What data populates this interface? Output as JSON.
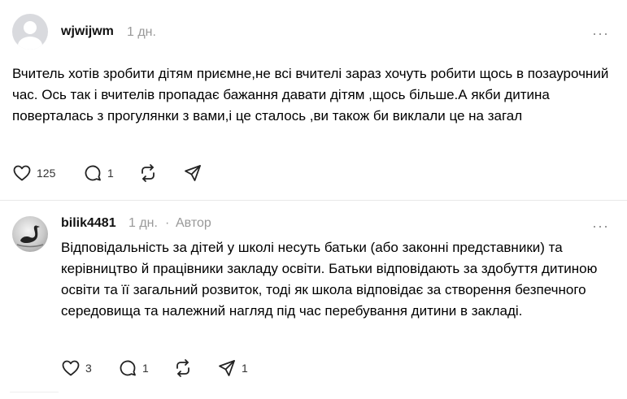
{
  "comments": [
    {
      "username": "wjwijwm",
      "time": "1 дн.",
      "author_tag": "",
      "text": "Вчитель хотів зробити дітям приємне,не всі вчителі зараз хочуть робити щось в позаурочний час. Ось так і вчителів пропадає бажання давати дітям ,щось більше.А якби дитина поверталась з прогулянки з вами,і це сталось ,ви також би виклали це на загал",
      "likes": "125",
      "replies": "1",
      "reposts": "",
      "shares": "",
      "avatar_icon": "default-user-avatar"
    },
    {
      "username": "bilik4481",
      "time": "1 дн.",
      "separator": "·",
      "author_tag": "Автор",
      "text": "Відповідальність за дітей у школі несуть батьки (або законні представники) та керівництво й працівники закладу освіти. Батьки відповідають за здобуття дитиною освіти та її загальний розвиток, тоді як школа відповідає за створення безпечного середовища та належний нагляд під час перебування дитини в закладі.",
      "likes": "3",
      "replies": "1",
      "reposts": "",
      "shares": "1",
      "avatar_icon": "swan-photo-avatar"
    }
  ],
  "more_label": "···",
  "colors": {
    "meta": "#999999",
    "text": "#000000",
    "divider": "#e9e9e9"
  }
}
